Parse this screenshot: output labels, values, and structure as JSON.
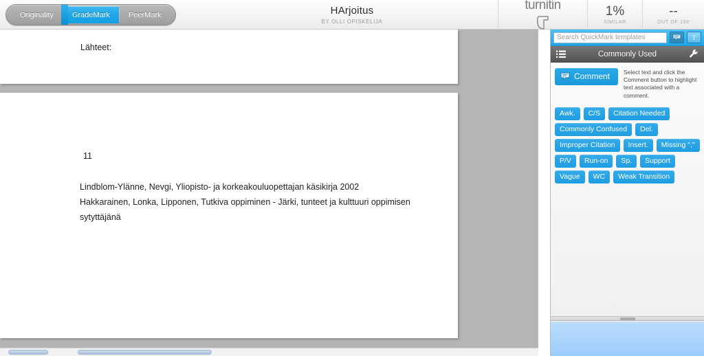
{
  "topbar": {
    "tabs": [
      {
        "label": "Originality",
        "active": false
      },
      {
        "label": "GradeMark",
        "active": true
      },
      {
        "label": "PeerMark",
        "active": false
      }
    ],
    "document_title": "HArjoitus",
    "document_author": "BY OLLI OPISKELIJA",
    "brand": "turnitin",
    "similarity_value": "1%",
    "similarity_label": "SIMILAR",
    "grade_value": "--",
    "grade_label": "OUT OF 100"
  },
  "document": {
    "page_one": {
      "heading": "Lähteet:"
    },
    "page_two": {
      "page_number": "11",
      "lines": [
        "Lindblom-Ylänne, Nevgi, Yliopisto- ja korkeakouluopettajan käsikirja 2002",
        "Hakkarainen, Lonka, Lipponen, Tutkiva oppiminen - Järki, tunteet ja kulttuuri oppimisen",
        "sytyttäjänä"
      ]
    }
  },
  "quickmark": {
    "search_placeholder": "Search QuickMark templates",
    "search_value": "",
    "toggle_comment_icon": "comment-bubble-icon",
    "toggle_text_icon": "T",
    "list_icon": "list-icon",
    "wrench_icon": "wrench-icon",
    "set_title": "Commonly Used",
    "comment_button_label": "Comment",
    "comment_help_text": "Select text and click the Comment button to highlight text associated with a comment.",
    "tags": [
      "Awk.",
      "C/S",
      "Citation Needed",
      "Commonly Confused",
      "Del.",
      "Improper Citation",
      "Insert.",
      "Missing \",\"",
      "P/V",
      "Run-on",
      "Sp.",
      "Support",
      "Vague",
      "WC",
      "Weak Transition"
    ]
  },
  "colors": {
    "accent_blue": "#1f9ce2",
    "tab_active": "#13a0e4",
    "panel_header": "#545454",
    "doc_background": "#b5b5b5",
    "lower_panel": "#9dcdfc"
  }
}
